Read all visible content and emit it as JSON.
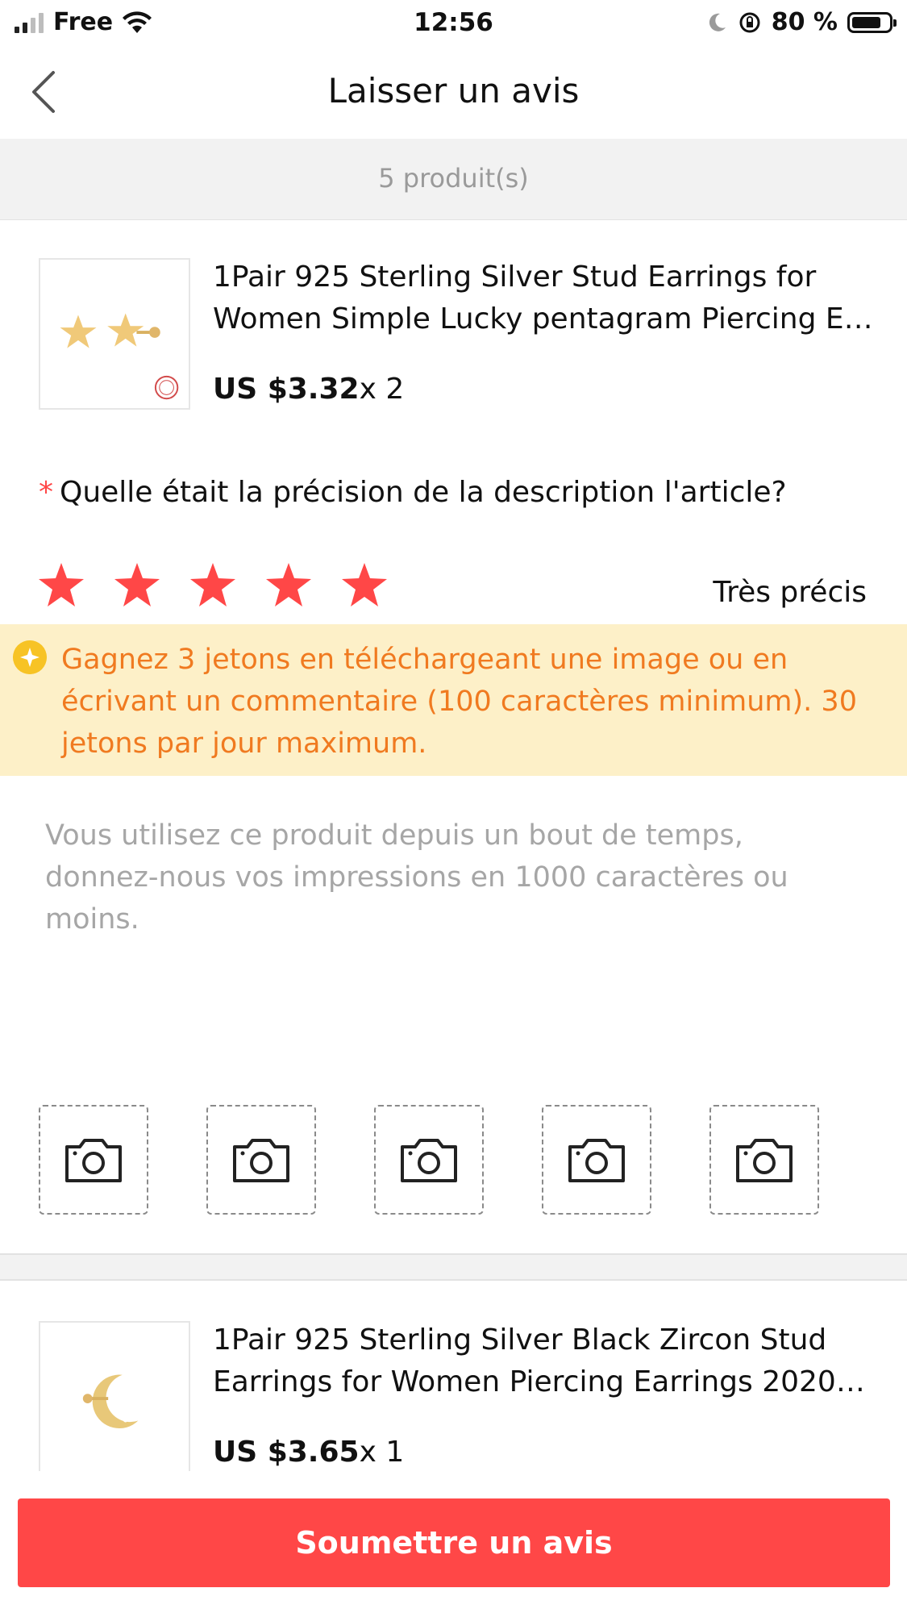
{
  "status_bar": {
    "carrier": "Free",
    "time": "12:56",
    "battery_percent": "80 %",
    "battery_level": 0.8,
    "icons": [
      "signal-icon",
      "wifi-icon",
      "moon-icon",
      "rotation-lock-icon",
      "battery-icon"
    ]
  },
  "nav": {
    "title": "Laisser un avis",
    "back_icon": "chevron-left-icon"
  },
  "product_count": "5 produit(s)",
  "products": [
    {
      "title_line1": "1Pair 925 Sterling Silver Stud Earrings for",
      "title_line2": "Women Simple Lucky pentagram Piercing Ea...",
      "price": "US $3.32",
      "quantity": "x 2",
      "image_icon": "star-earrings-image"
    },
    {
      "title_line1": "1Pair 925 Sterling Silver Black Zircon Stud",
      "title_line2": "Earrings for Women Piercing Earrings 2020 S...",
      "price": "US $3.65",
      "quantity": "x 1",
      "image_icon": "moon-earring-image"
    }
  ],
  "rating": {
    "required_mark": "*",
    "question": "Quelle était la précision de la description l'article?",
    "stars_filled": 5,
    "stars_total": 5,
    "label": "Très précis",
    "star_color": "#ff4747"
  },
  "tip": {
    "text": "Gagnez 3 jetons en téléchargeant une image ou en écrivant un commentaire (100 caractères minimum). 30 jetons par jour maximum.",
    "text_color": "#f07a20",
    "background": "#fdf0c8",
    "icon": "coin-icon"
  },
  "review": {
    "value": "",
    "placeholder": "Vous utilisez ce produit depuis un bout de temps, donnez-nous vos impressions en 1000 caractères ou moins."
  },
  "photo_slots": {
    "count": 5,
    "icon": "camera-icon"
  },
  "submit": {
    "label": "Soumettre un avis",
    "color": "#ff4747"
  }
}
